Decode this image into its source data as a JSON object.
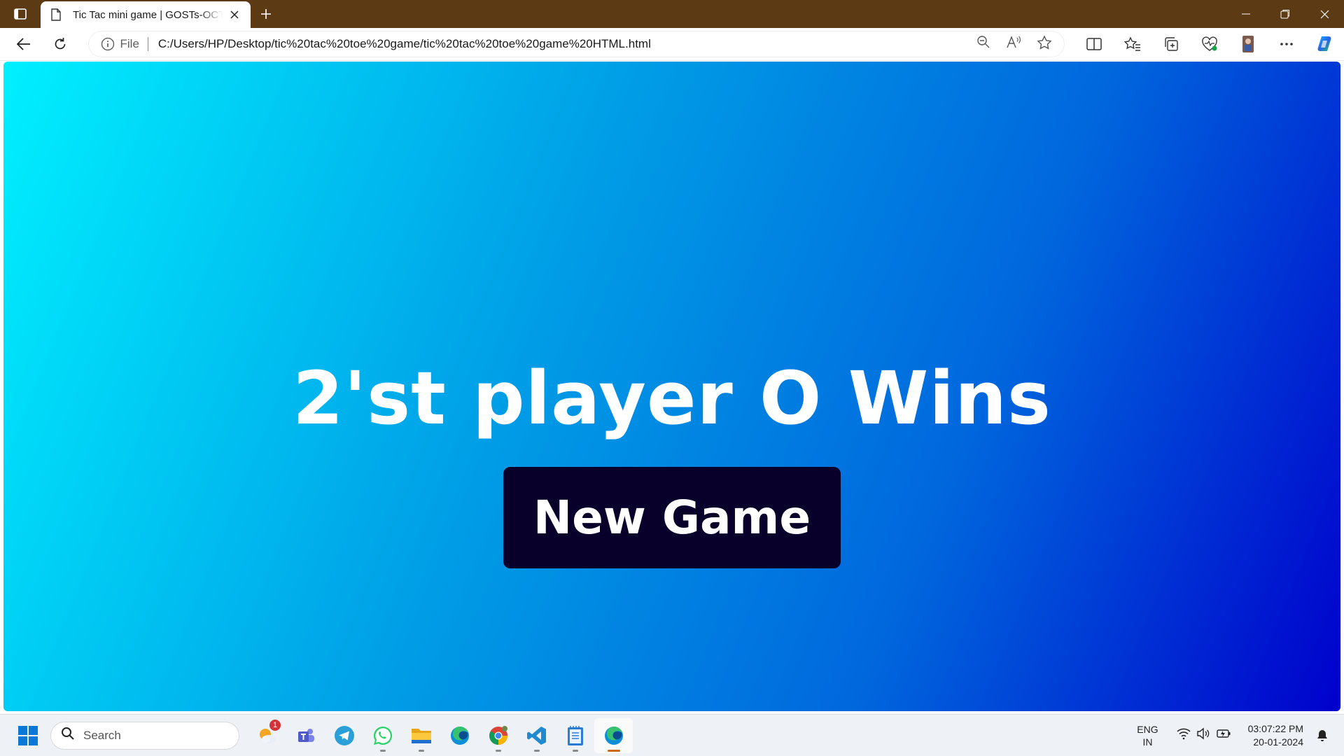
{
  "browser": {
    "tab": {
      "title": "Tic Tac mini game | GOSTs-OCTO"
    },
    "address": {
      "scheme_label": "File",
      "url": "C:/Users/HP/Desktop/tic%20tac%20toe%20game/tic%20tac%20toe%20game%20HTML.html"
    }
  },
  "page": {
    "result_text": "2'st player O Wins",
    "new_game_label": "New Game",
    "colors": {
      "gradient_start": "#00f0ff",
      "gradient_end": "#0000cc",
      "button_bg": "#08002a"
    }
  },
  "taskbar": {
    "search_placeholder": "Search",
    "weather_badge": "1",
    "apps": [
      "weather-widget",
      "teams",
      "telegram",
      "whatsapp",
      "file-explorer",
      "edge",
      "chrome",
      "vscode",
      "notepad",
      "edge-active"
    ],
    "language": {
      "line1": "ENG",
      "line2": "IN"
    },
    "time": "03:07:22 PM",
    "date": "20-01-2024"
  }
}
